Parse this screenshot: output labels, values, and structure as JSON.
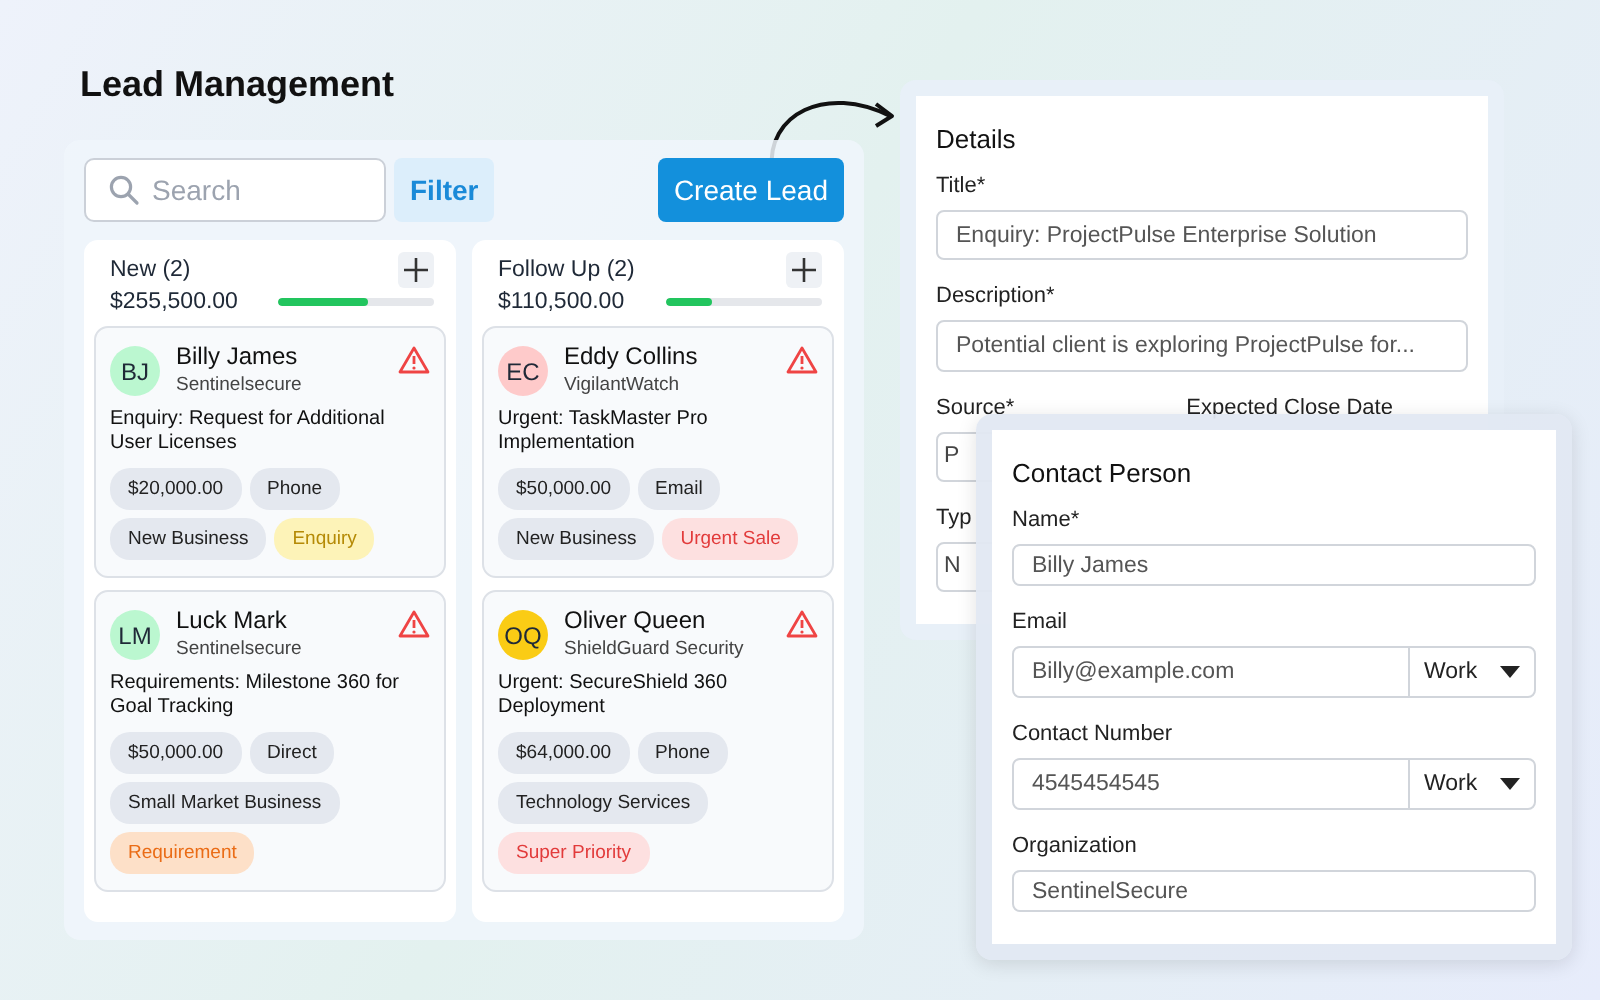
{
  "page_title": "Lead Management",
  "toolbar": {
    "search": {
      "placeholder": "Search"
    },
    "filter_button": "Filter",
    "create_button": "Create Lead"
  },
  "columns": [
    {
      "title": "New (2)",
      "total": "$255,500.00",
      "level": 0.58,
      "cards": [
        {
          "initials": "BJ",
          "color": "#bbf7d0",
          "name": "Billy James",
          "company": "Sentinelsecure",
          "title": "Enquiry: Request for Additional User Licenses",
          "tags": [
            {
              "label": "$20,000.00",
              "kind": "neutral"
            },
            {
              "label": "Phone",
              "kind": "neutral"
            },
            {
              "label": "New Business",
              "kind": "neutral"
            },
            {
              "label": "Enquiry",
              "kind": "yellow"
            }
          ]
        },
        {
          "initials": "LM",
          "color": "#bbf7d0",
          "name": "Luck Mark",
          "company": "Sentinelsecure",
          "title": "Requirements: Milestone 360 for Goal Tracking",
          "tags": [
            {
              "label": "$50,000.00",
              "kind": "neutral"
            },
            {
              "label": "Direct",
              "kind": "neutral"
            },
            {
              "label": "Small Market Business",
              "kind": "neutral"
            },
            {
              "label": "Requirement",
              "kind": "orange"
            }
          ]
        }
      ]
    },
    {
      "title": "Follow Up (2)",
      "total": "$110,500.00",
      "level": 0.29,
      "cards": [
        {
          "initials": "EC",
          "color": "#fecaca",
          "name": "Eddy Collins",
          "company": "VigilantWatch",
          "title": "Urgent: TaskMaster Pro Implementation",
          "tags": [
            {
              "label": "$50,000.00",
              "kind": "neutral"
            },
            {
              "label": "Email",
              "kind": "neutral"
            },
            {
              "label": "New Business",
              "kind": "neutral"
            },
            {
              "label": "Urgent Sale",
              "kind": "red"
            }
          ]
        },
        {
          "initials": "OQ",
          "color": "#facc15",
          "name": "Oliver Queen",
          "company": "ShieldGuard Security",
          "title": "Urgent: SecureShield 360 Deployment",
          "tags": [
            {
              "label": "$64,000.00",
              "kind": "neutral"
            },
            {
              "label": "Phone",
              "kind": "neutral"
            },
            {
              "label": "Technology Services",
              "kind": "neutral"
            },
            {
              "label": "Super Priority",
              "kind": "red"
            }
          ]
        }
      ]
    }
  ],
  "details": {
    "heading": "Details",
    "title_label": "Title*",
    "title_value": "Enquiry: ProjectPulse Enterprise Solution",
    "description_label": "Description*",
    "description_value": "Potential client is exploring ProjectPulse for...",
    "source_label": "Source*",
    "close_date_label": "Expected Close Date",
    "source_value": "P",
    "type_label": "Typ",
    "type_value": "N"
  },
  "contact": {
    "heading": "Contact Person",
    "name_label": "Name*",
    "name_value": "Billy James",
    "email_label": "Email",
    "email_value": "Billy@example.com",
    "email_type": "Work",
    "phone_label": "Contact Number",
    "phone_value": "4545454545",
    "phone_type": "Work",
    "org_label": "Organization",
    "org_value": "SentinelSecure"
  }
}
